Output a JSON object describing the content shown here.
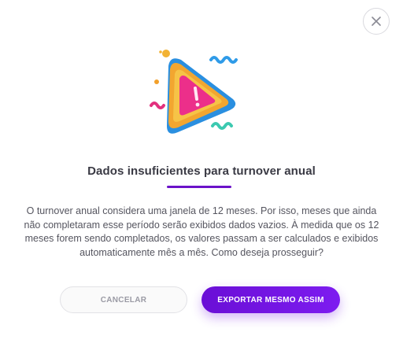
{
  "modal": {
    "title": "Dados insuficientes para turnover anual",
    "description": "O turnover anual considera uma janela de 12 meses. Por isso, meses que ainda não completaram esse período serão exibidos dados vazios. À medida que os 12 meses forem sendo completados, os valores passam a ser calculados e exibidos automaticamente mês a mês. Como deseja prosseguir?",
    "cancel_label": "CANCELAR",
    "confirm_label": "EXPORTAR MESMO ASSIM",
    "close_icon": "close-icon",
    "illustration_icon": "warning-triangle-icon",
    "accent_color": "#6b12c9"
  }
}
